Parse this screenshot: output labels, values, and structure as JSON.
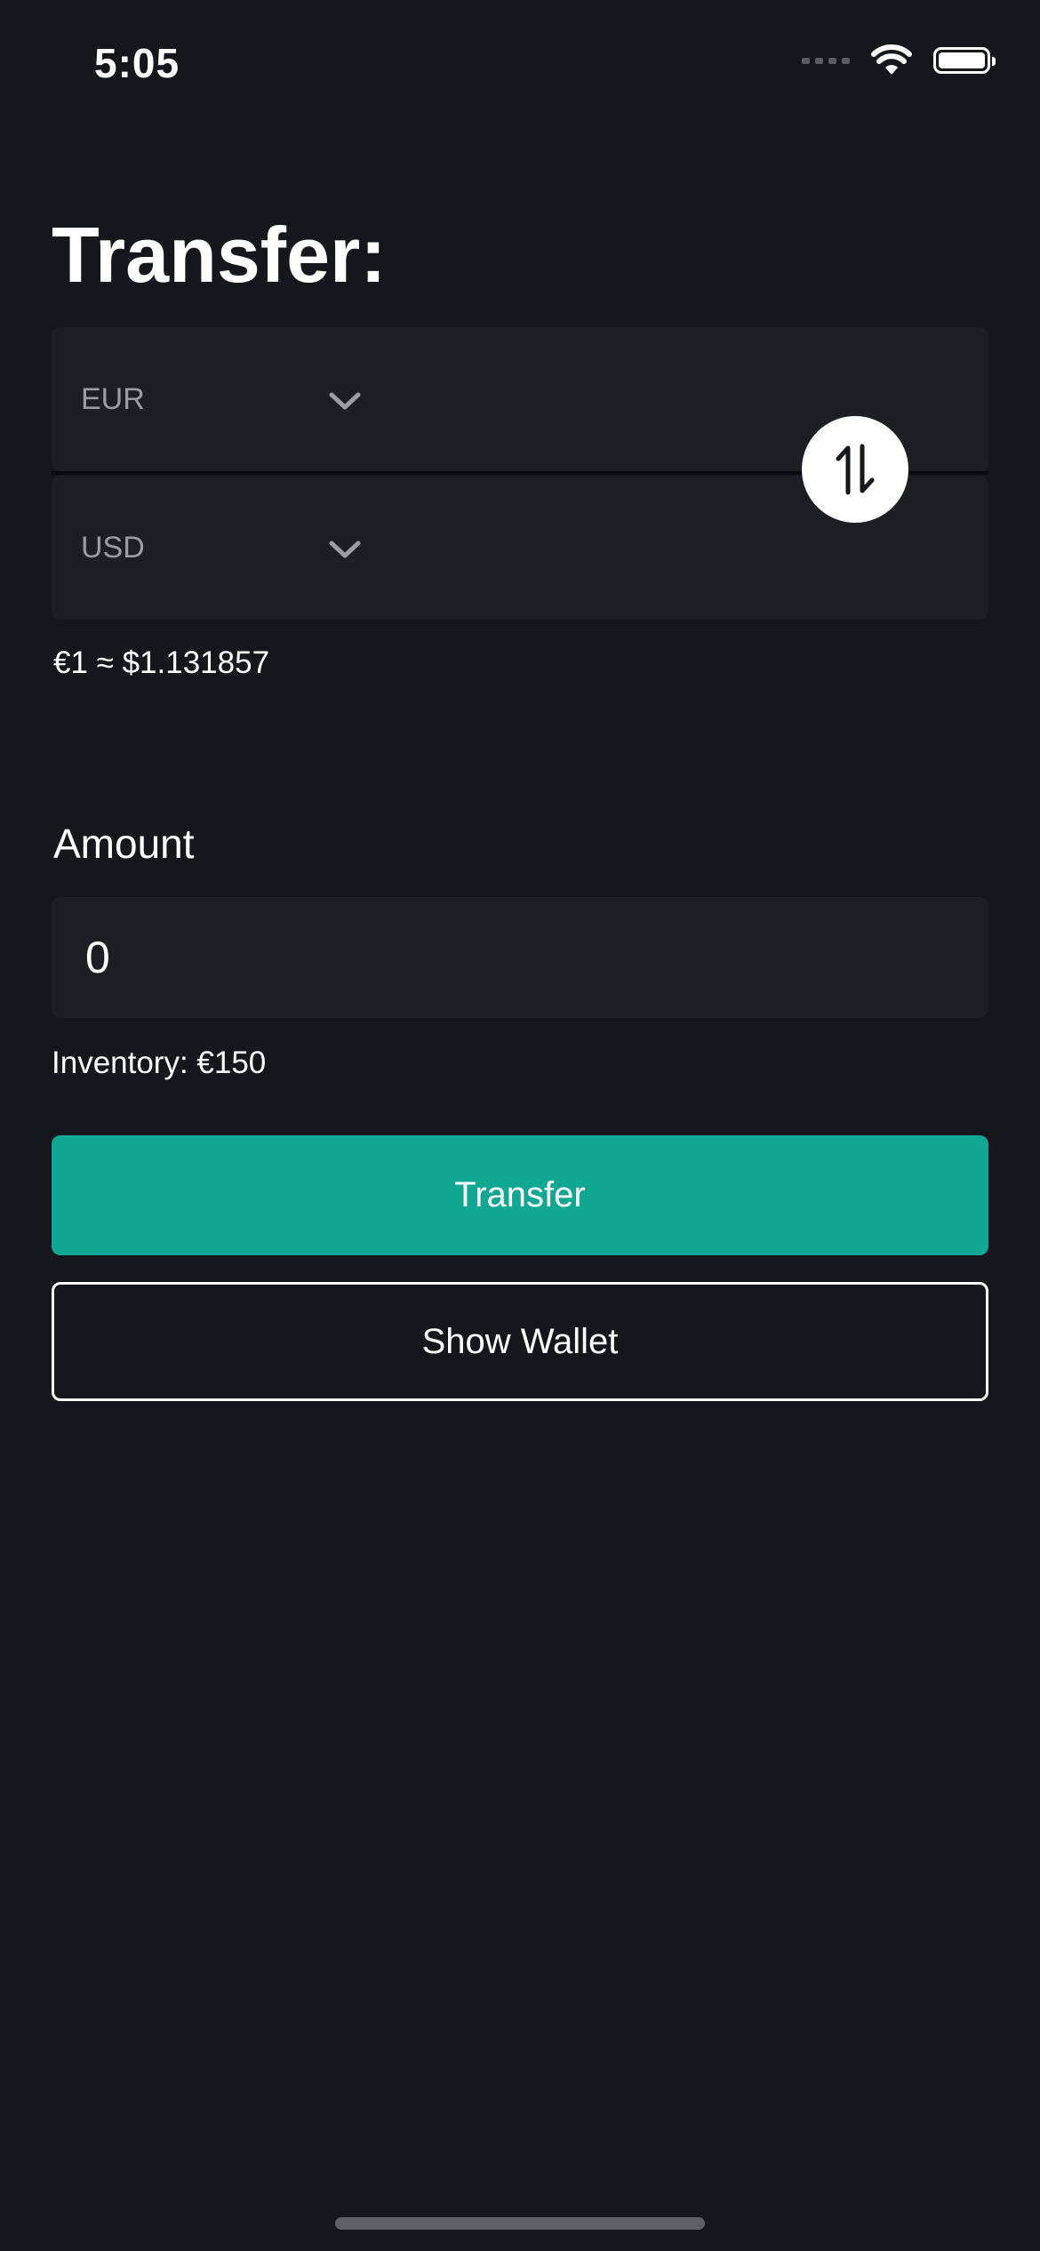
{
  "status_bar": {
    "time": "5:05",
    "signal_icon": "signal-dots-icon",
    "wifi_icon": "wifi-icon",
    "battery_icon": "battery-full-icon"
  },
  "page": {
    "title": "Transfer:"
  },
  "exchange": {
    "from_currency": "EUR",
    "to_currency": "USD",
    "rate_text": "€1 ≈ $1.131857",
    "swap_icon": "swap-arrows-icon"
  },
  "amount": {
    "label": "Amount",
    "value": "0"
  },
  "inventory": {
    "text": "Inventory: €150"
  },
  "actions": {
    "transfer_label": "Transfer",
    "wallet_label": "Show Wallet"
  },
  "colors": {
    "background": "#15171d",
    "field": "#1d1f24",
    "accent": "#10a893",
    "text": "#ffffff",
    "muted": "#9b9da1"
  }
}
